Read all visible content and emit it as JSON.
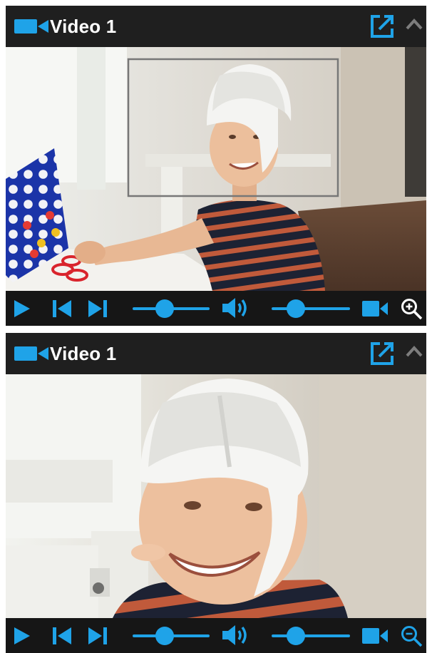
{
  "panels": [
    {
      "title": "Video 1",
      "zoom_mode": "zoom-in",
      "seek_fraction": 0.42,
      "volume_fraction": 0.31
    },
    {
      "title": "Video 1",
      "zoom_mode": "zoom-out",
      "seek_fraction": 0.42,
      "volume_fraction": 0.31
    }
  ],
  "icons": {
    "title": "video-camera-icon",
    "popout": "external-link-icon",
    "collapse": "chevron-up-icon",
    "play": "play-icon",
    "previous": "skip-previous-icon",
    "next": "skip-next-icon",
    "volume": "speaker-icon",
    "camera": "video-camera-icon",
    "zoom_in": "zoom-in-icon",
    "zoom_out": "zoom-out-icon"
  },
  "colors": {
    "accent": "#1fa3e8",
    "titlebar": "#1f1f1f",
    "controlbar": "#161616",
    "title_text": "#ffffff"
  }
}
